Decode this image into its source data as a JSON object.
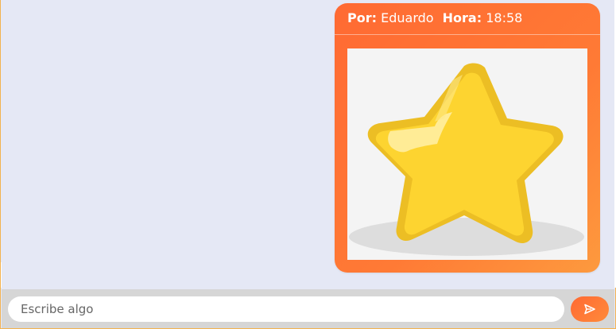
{
  "message": {
    "author_label": "Por:",
    "author": "Eduardo",
    "time_label": "Hora:",
    "time": "18:58",
    "image_icon": "star-icon"
  },
  "composer": {
    "placeholder": "Escribe algo",
    "send_icon": "send-icon"
  },
  "colors": {
    "background": "#e5e8f5",
    "accent": "#ff6a33",
    "accent_end": "#fd9a3e",
    "star": "#fdd430"
  }
}
